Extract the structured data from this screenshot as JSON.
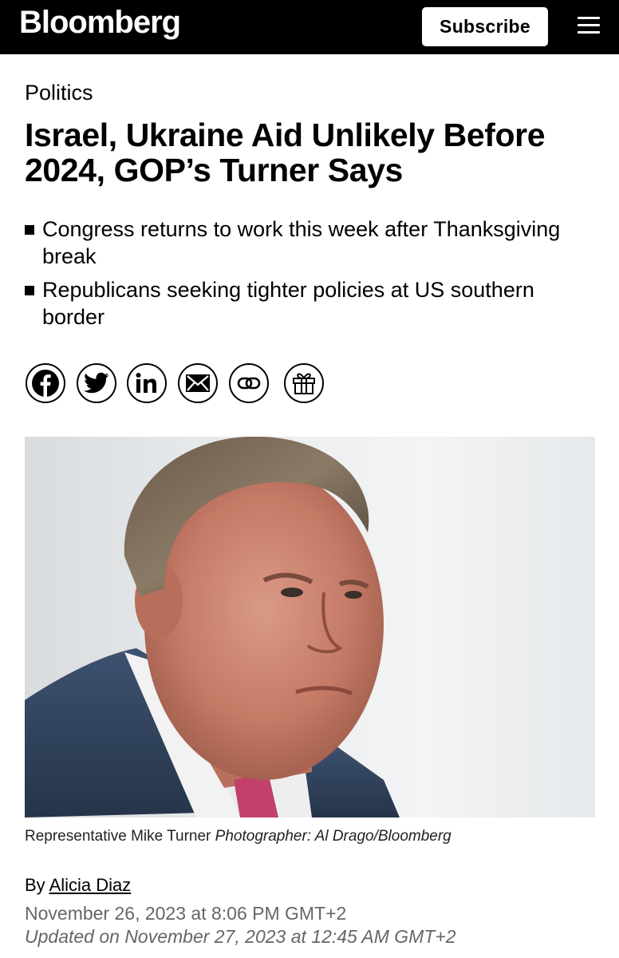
{
  "header": {
    "logo_text": "Bloomberg",
    "subscribe_label": "Subscribe",
    "menu_icon": "hamburger-menu-icon"
  },
  "article": {
    "section": "Politics",
    "headline": "Israel, Ukraine Aid Unlikely Before 2024, GOP’s Turner Says",
    "bullets": [
      "Congress returns to work this week after Thanksgiving break",
      "Republicans seeking tighter policies at US southern border"
    ],
    "share_icons": [
      "facebook-icon",
      "twitter-icon",
      "linkedin-icon",
      "email-icon",
      "link-icon",
      "gift-icon"
    ],
    "caption_subject": "Representative Mike Turner",
    "caption_credit": "Photographer: Al Drago/Bloomberg",
    "byline_prefix": "By",
    "author": "Alicia Diaz",
    "published": "November 26, 2023 at 8:06 PM GMT+2",
    "updated": "Updated on November 27, 2023 at 12:45 AM GMT+2"
  },
  "colors": {
    "header_bg": "#000000",
    "text": "#000000",
    "muted_text": "#666666"
  }
}
